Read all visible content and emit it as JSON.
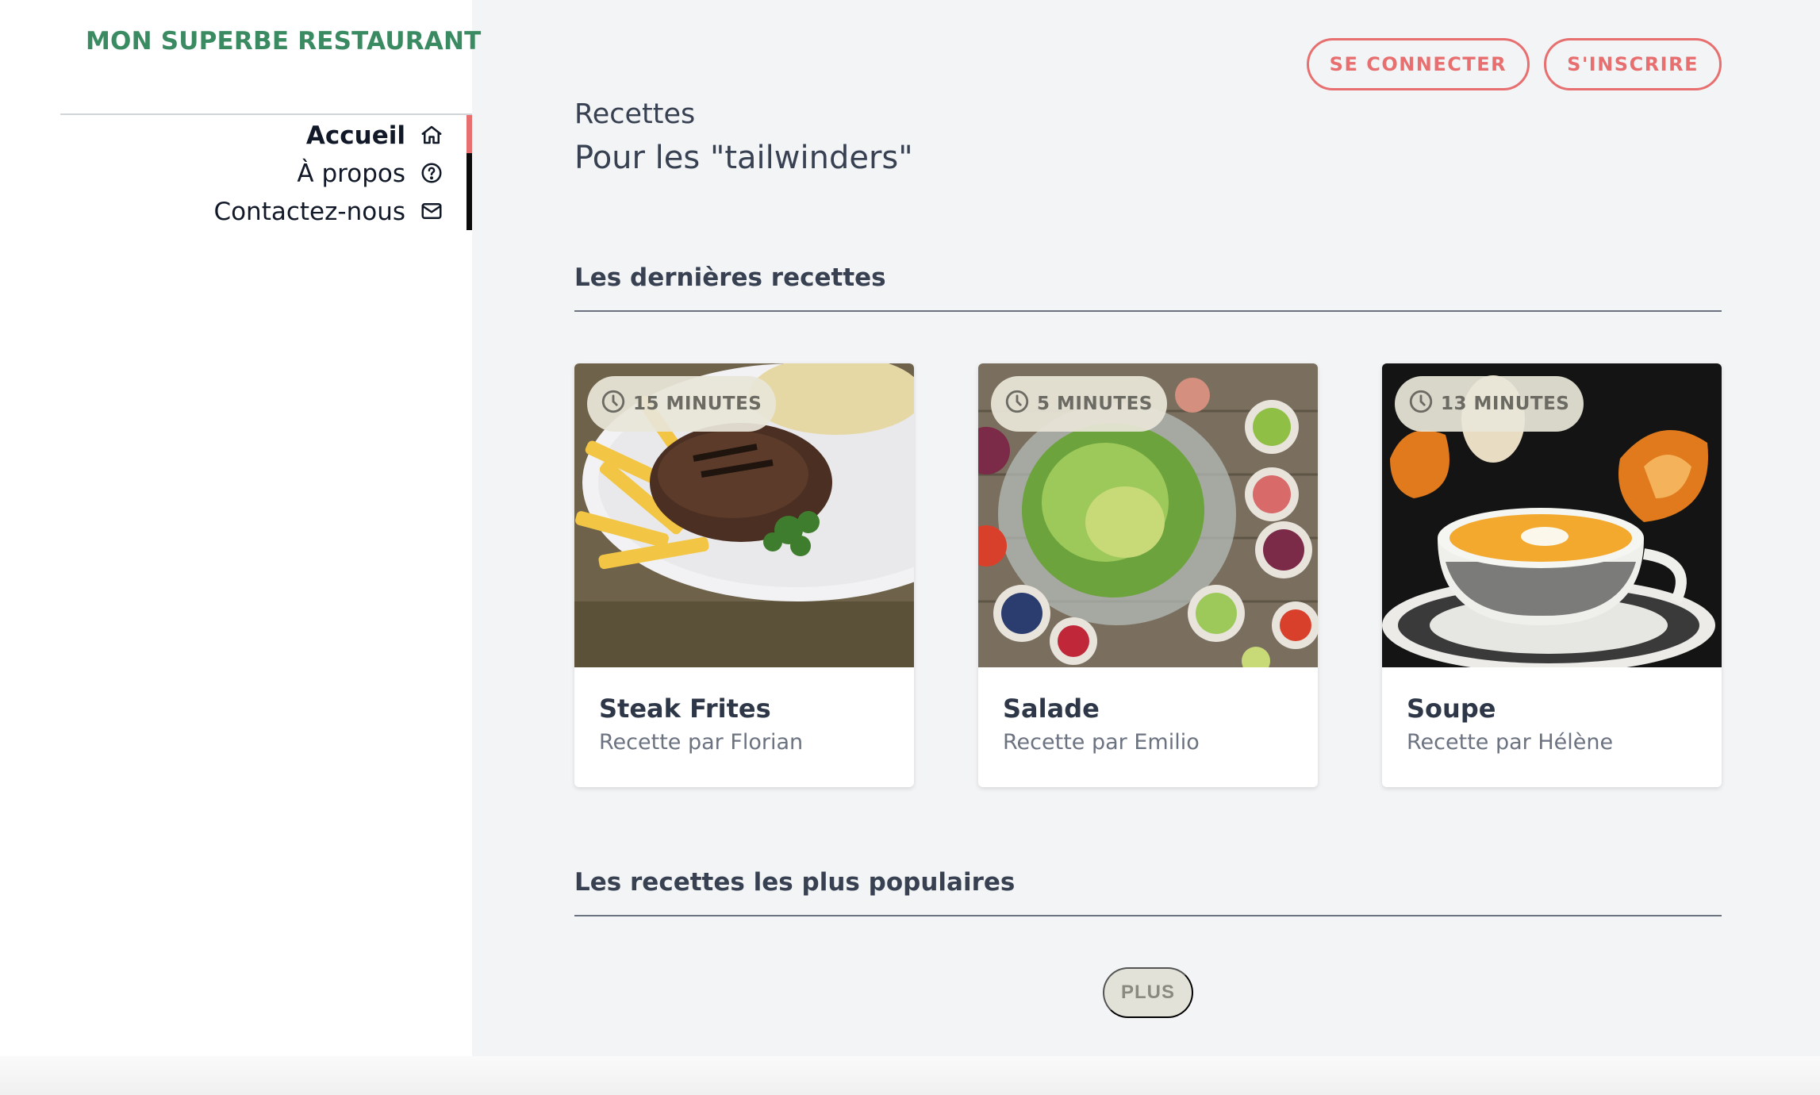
{
  "brand": {
    "name": "MON SUPERBE RESTAURANT",
    "color": "#3a8a62"
  },
  "nav": {
    "items": [
      {
        "label": "Accueil",
        "icon": "home-icon",
        "active": true
      },
      {
        "label": "À propos",
        "icon": "help-circle-icon",
        "active": false
      },
      {
        "label": "Contactez-nous",
        "icon": "mail-icon",
        "active": false
      }
    ]
  },
  "auth": {
    "login_label": "SE CONNECTER",
    "signup_label": "S'INSCRIRE"
  },
  "header": {
    "title": "Recettes",
    "subtitle": "Pour les \"tailwinders\""
  },
  "sections": {
    "latest": "Les dernières recettes",
    "popular": "Les recettes les plus populaires"
  },
  "recipes": [
    {
      "time": "15 MINUTES",
      "title": "Steak Frites",
      "author": "Recette par Florian",
      "image": "steak-frites-photo"
    },
    {
      "time": "5 MINUTES",
      "title": "Salade",
      "author": "Recette par Emilio",
      "image": "salad-photo"
    },
    {
      "time": "13 MINUTES",
      "title": "Soupe",
      "author": "Recette par Hélène",
      "image": "soup-photo"
    }
  ],
  "more_label": "PLUS",
  "colors": {
    "accent": "#e76f6f",
    "background": "#f3f4f6",
    "badge": "#e8e5d8"
  }
}
